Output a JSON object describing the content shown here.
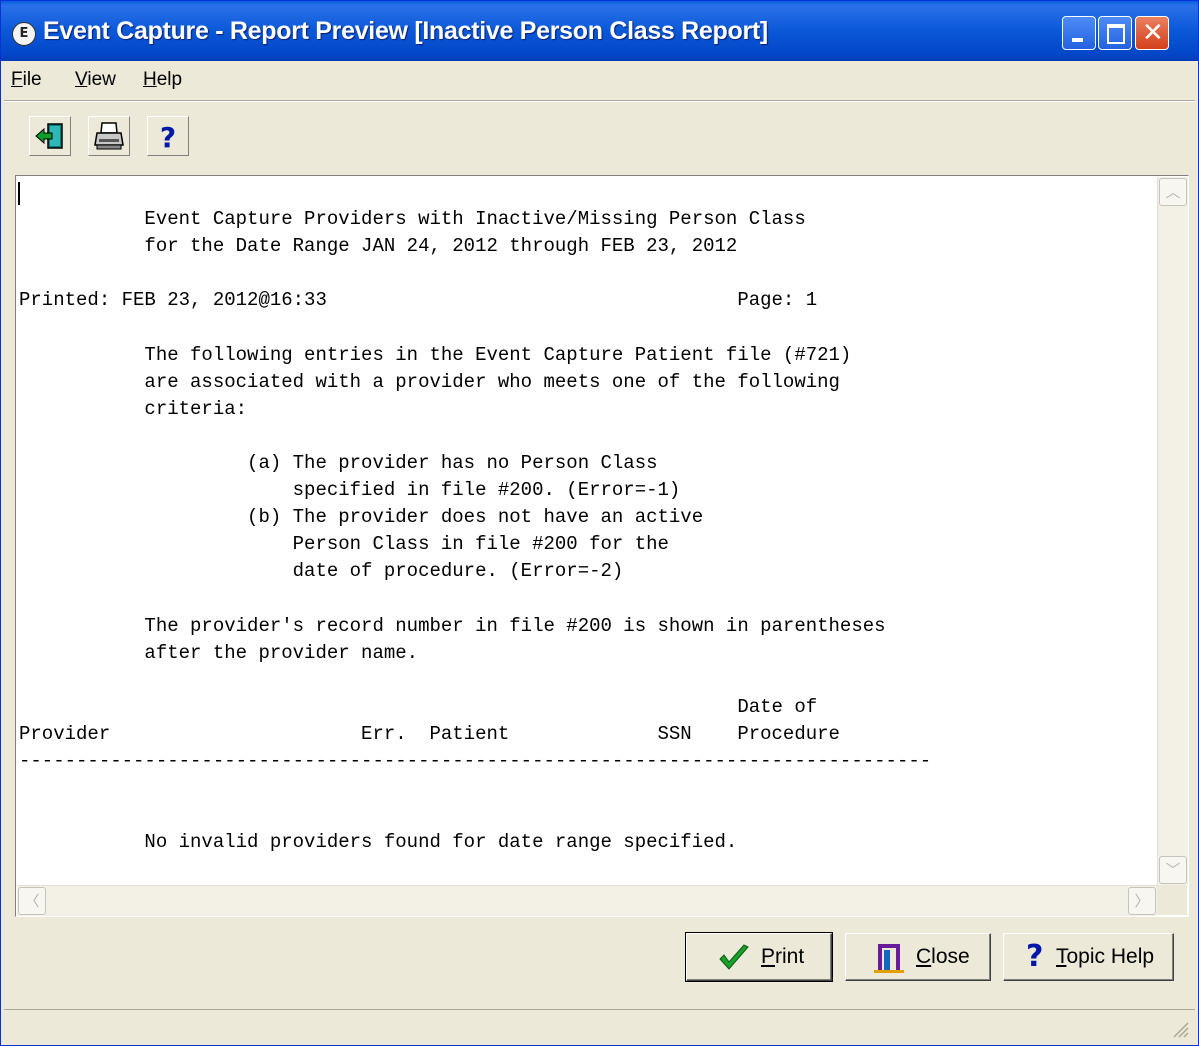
{
  "window": {
    "title": "Event Capture - Report Preview [Inactive Person Class Report]",
    "icon_letter": "E"
  },
  "menubar": {
    "items": [
      {
        "label_u": "F",
        "label_rest": "ile"
      },
      {
        "label_u": "V",
        "label_rest": "iew"
      },
      {
        "label_u": "H",
        "label_rest": "elp"
      }
    ]
  },
  "toolbar": {
    "buttons": [
      "exit-icon",
      "printer-icon",
      "help-icon"
    ],
    "help_glyph": "?"
  },
  "report": {
    "text": "\n           Event Capture Providers with Inactive/Missing Person Class\n           for the Date Range JAN 24, 2012 through FEB 23, 2012\n\nPrinted: FEB 23, 2012@16:33                                    Page: 1\n\n           The following entries in the Event Capture Patient file (#721)\n           are associated with a provider who meets one of the following\n           criteria:\n\n                    (a) The provider has no Person Class\n                        specified in file #200. (Error=-1)\n                    (b) The provider does not have an active\n                        Person Class in file #200 for the\n                        date of procedure. (Error=-2)\n\n           The provider's record number in file #200 is shown in parentheses\n           after the provider name.\n\n                                                               Date of\nProvider                      Err.  Patient             SSN    Procedure\n--------------------------------------------------------------------------------\n\n\n           No invalid providers found for date range specified."
  },
  "buttons": {
    "print": {
      "u": "P",
      "rest": "rint"
    },
    "close": {
      "u": "C",
      "rest": "lose"
    },
    "help": {
      "u": "T",
      "rest": "opic Help",
      "glyph": "?"
    }
  }
}
